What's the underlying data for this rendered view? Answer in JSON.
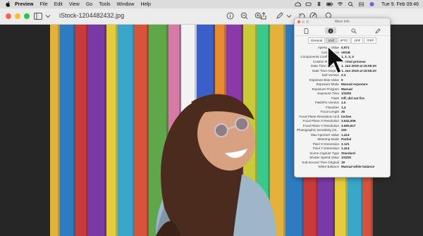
{
  "menubar": {
    "menus": [
      "Preview",
      "File",
      "Edit",
      "View",
      "Go",
      "Tools",
      "Window",
      "Help"
    ],
    "clock": "Tue 9. Feb 09:46"
  },
  "window": {
    "title": "iStock-1204482432.jpg"
  },
  "inspector": {
    "title": "More Info",
    "tabs": [
      "General",
      "Exif",
      "IPTC",
      "JFIF",
      "TIFF"
    ],
    "active_tab": "Exif",
    "rows": [
      {
        "key": "Aperture Value",
        "value": "0,971"
      },
      {
        "key": "Color Space",
        "value": "sRGB"
      },
      {
        "key": "Components Configuration",
        "value": "1, 2, 3, 0"
      },
      {
        "key": "Custom Rendered",
        "value": "Normal process"
      },
      {
        "key": "Date Time Digitized",
        "value": "1. Jun 2019 at 15:05:20"
      },
      {
        "key": "Date Time Original",
        "value": "1. Jun 2019 at 15:05:20"
      },
      {
        "key": "Exif Version",
        "value": "2.3"
      },
      {
        "key": "Exposure Bias Value",
        "value": "0"
      },
      {
        "key": "Exposure Mode",
        "value": "Manual exposure"
      },
      {
        "key": "Exposure Program",
        "value": "Manual"
      },
      {
        "key": "Exposure Time",
        "value": "1/3200"
      },
      {
        "key": "Flash",
        "value": "Off, did not fire"
      },
      {
        "key": "FlashPix Version",
        "value": "1.0"
      },
      {
        "key": "FNumber",
        "value": "1,4"
      },
      {
        "key": "Focal Length",
        "value": "35"
      },
      {
        "key": "Focal Plane Resolution Unit",
        "value": "inches"
      },
      {
        "key": "Focal Plane X Resolution",
        "value": "3.642,006"
      },
      {
        "key": "Focal Plane Y Resolution",
        "value": "3.650,617"
      },
      {
        "key": "Photographic Sensitivity (IS...",
        "value": "200"
      },
      {
        "key": "Max Aperture Value",
        "value": "1,414"
      },
      {
        "key": "Metering Mode",
        "value": "Partial"
      },
      {
        "key": "Pixel X Dimension",
        "value": "2.121"
      },
      {
        "key": "Pixel Y Dimension",
        "value": "1.414"
      },
      {
        "key": "Scene Capture Type",
        "value": "Standard"
      },
      {
        "key": "Shutter Speed Value",
        "value": "1/3200"
      },
      {
        "key": "Sub-second Time Original",
        "value": "19"
      },
      {
        "key": "White Balance",
        "value": "Manual white balance"
      }
    ]
  },
  "colors": {
    "menubar_bg": "#dcdcdc",
    "titlebar_bg": "#ececec",
    "close": "#ff5f57",
    "minimize": "#febc2e",
    "zoom": "#28c840",
    "stripes": [
      "#e4b23a",
      "#2e7cc0",
      "#c93a3a",
      "#7a3aa6",
      "#e6cc3a",
      "#3aa6c9",
      "#d9533a",
      "#5fa84a",
      "#d87aa8",
      "#f2f2f2",
      "#3a5fc9",
      "#e88a2e",
      "#8a3aa6",
      "#c9c93a",
      "#3ac98a"
    ]
  }
}
